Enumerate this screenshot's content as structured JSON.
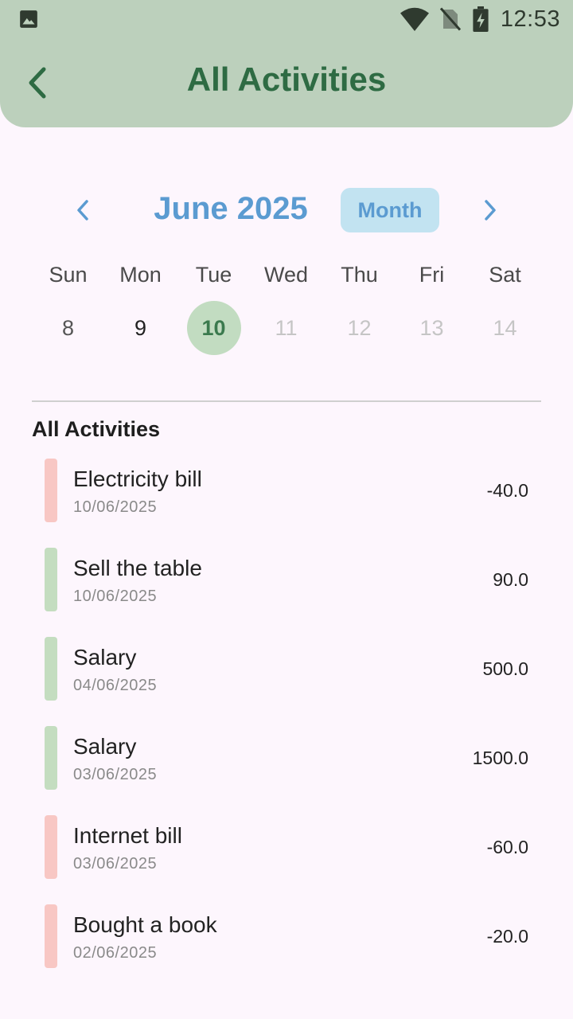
{
  "status_bar": {
    "time": "12:53",
    "icons": [
      "gallery-icon",
      "wifi-icon",
      "no-sim-icon",
      "battery-charging-icon"
    ]
  },
  "header": {
    "title": "All Activities",
    "back_icon": "chevron-left-icon",
    "color": "#bcd0bc",
    "title_color": "#2e6b43"
  },
  "calendar": {
    "month_label": "June 2025",
    "format_button": "Month",
    "prev_icon": "chevron-left-icon",
    "next_icon": "chevron-right-icon",
    "weekdays": [
      "Sun",
      "Mon",
      "Tue",
      "Wed",
      "Thu",
      "Fri",
      "Sat"
    ],
    "days": [
      "8",
      "9",
      "10",
      "11",
      "12",
      "13",
      "14"
    ],
    "selected_day": "10",
    "accent": "#5b9bd1"
  },
  "activities": {
    "section_title": "All Activities",
    "items": [
      {
        "name": "Electricity bill",
        "date": "10/06/2025",
        "amount": "-40.0",
        "type": "expense"
      },
      {
        "name": "Sell the table",
        "date": "10/06/2025",
        "amount": "90.0",
        "type": "income"
      },
      {
        "name": "Salary",
        "date": "04/06/2025",
        "amount": "500.0",
        "type": "income"
      },
      {
        "name": "Salary",
        "date": "03/06/2025",
        "amount": "1500.0",
        "type": "income"
      },
      {
        "name": "Internet bill",
        "date": "03/06/2025",
        "amount": "-60.0",
        "type": "expense"
      },
      {
        "name": "Bought a book",
        "date": "02/06/2025",
        "amount": "-20.0",
        "type": "expense"
      }
    ],
    "colors": {
      "expense": "#f8c7c4",
      "income": "#c4ddc0"
    }
  }
}
